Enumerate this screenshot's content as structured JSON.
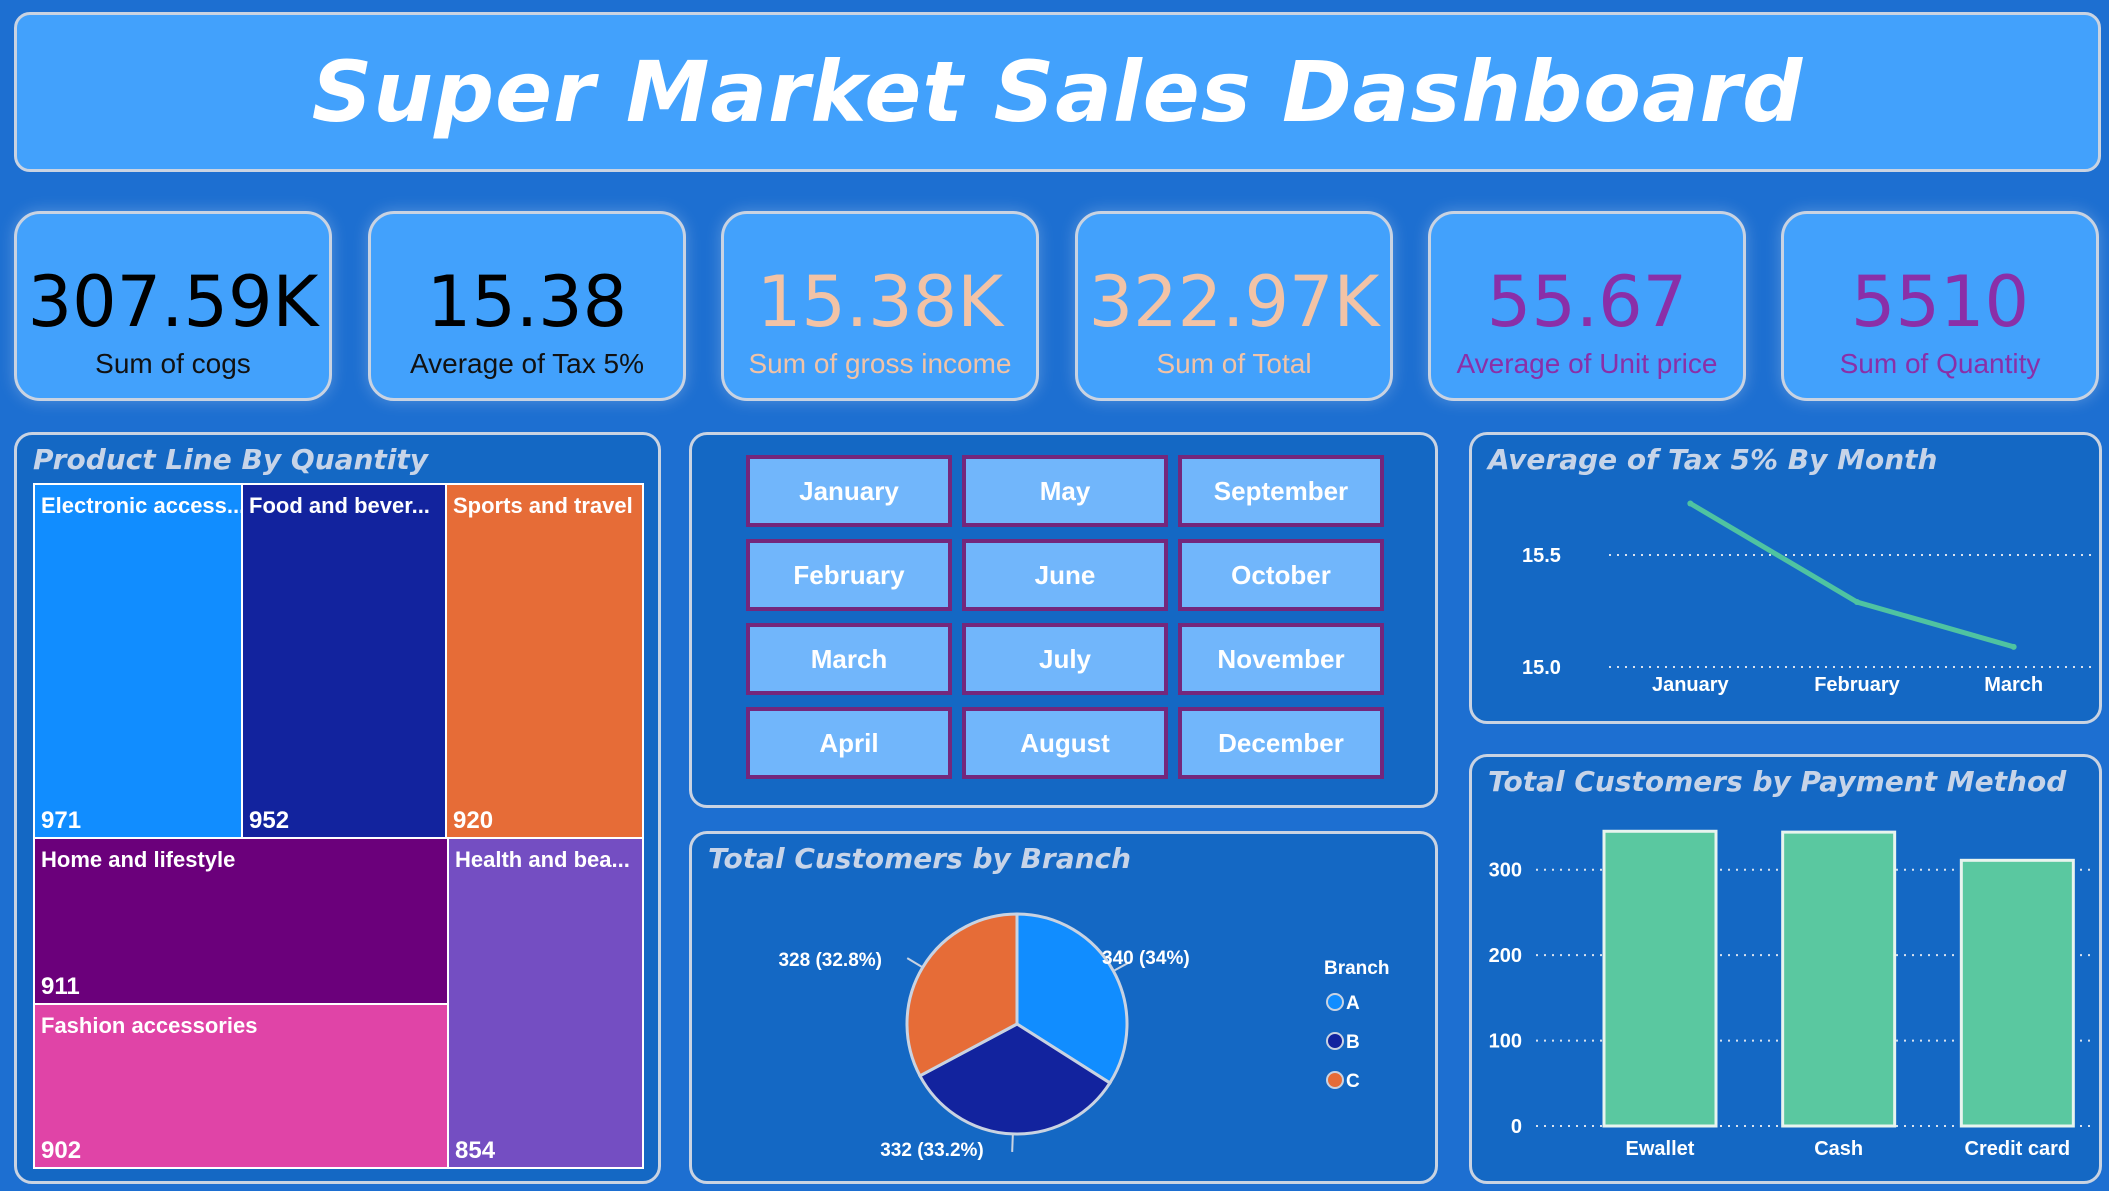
{
  "header": {
    "title": "Super Market Sales Dashboard"
  },
  "kpis": [
    {
      "value": "307.59K",
      "label": "Sum of cogs",
      "value_color": "#000000",
      "label_color": "#111111"
    },
    {
      "value": "15.38",
      "label": "Average of Tax 5%",
      "value_color": "#000000",
      "label_color": "#111111"
    },
    {
      "value": "15.38K",
      "label": "Sum of gross income",
      "value_color": "#f2c3a6",
      "label_color": "#f2c3a6"
    },
    {
      "value": "322.97K",
      "label": "Sum of Total",
      "value_color": "#f2c3a6",
      "label_color": "#f2c3a6"
    },
    {
      "value": "55.67",
      "label": "Average of Unit price",
      "value_color": "#8a2fa8",
      "label_color": "#8a2fa8"
    },
    {
      "value": "5510",
      "label": "Sum of Quantity",
      "value_color": "#8a2fa8",
      "label_color": "#8a2fa8"
    }
  ],
  "treemap": {
    "title": "Product Line By Quantity",
    "items": [
      {
        "name": "Electronic access...",
        "value": 971,
        "color": "#118dff"
      },
      {
        "name": "Food and bever...",
        "value": 952,
        "color": "#12239e"
      },
      {
        "name": "Sports and travel",
        "value": 920,
        "color": "#e66c37"
      },
      {
        "name": "Home and lifestyle",
        "value": 911,
        "color": "#6b007b"
      },
      {
        "name": "Fashion accessories",
        "value": 902,
        "color": "#e044a7"
      },
      {
        "name": "Health and bea...",
        "value": 854,
        "color": "#744ec2"
      }
    ]
  },
  "month_slicer": {
    "months": [
      "January",
      "May",
      "September",
      "February",
      "June",
      "October",
      "March",
      "July",
      "November",
      "April",
      "August",
      "December"
    ]
  },
  "line_chart": {
    "title": "Average of Tax 5% By Month",
    "chart_data": {
      "type": "line",
      "categories": [
        "January",
        "February",
        "March"
      ],
      "values": [
        15.73,
        15.29,
        15.09
      ],
      "y_ticks": [
        "15.0",
        "15.5"
      ],
      "ylim": [
        15.0,
        15.5
      ],
      "color": "#4fc3a1",
      "grid": true
    }
  },
  "pie_chart": {
    "title": "Total Customers by Branch",
    "legend_title": "Branch",
    "chart_data": {
      "type": "pie",
      "slices": [
        {
          "name": "A",
          "value": 340,
          "label": "340 (34%)",
          "color": "#118dff"
        },
        {
          "name": "B",
          "value": 332,
          "label": "332 (33.2%)",
          "color": "#12239e"
        },
        {
          "name": "C",
          "value": 328,
          "label": "328 (32.8%)",
          "color": "#e66c37"
        }
      ]
    }
  },
  "bar_chart": {
    "title": "Total Customers by Payment Method",
    "chart_data": {
      "type": "bar",
      "categories": [
        "Ewallet",
        "Cash",
        "Credit card"
      ],
      "values": [
        345,
        344,
        311
      ],
      "y_ticks": [
        "0",
        "100",
        "200",
        "300"
      ],
      "ylim": [
        0,
        350
      ],
      "color": "#5ac8a0",
      "grid": true
    }
  }
}
